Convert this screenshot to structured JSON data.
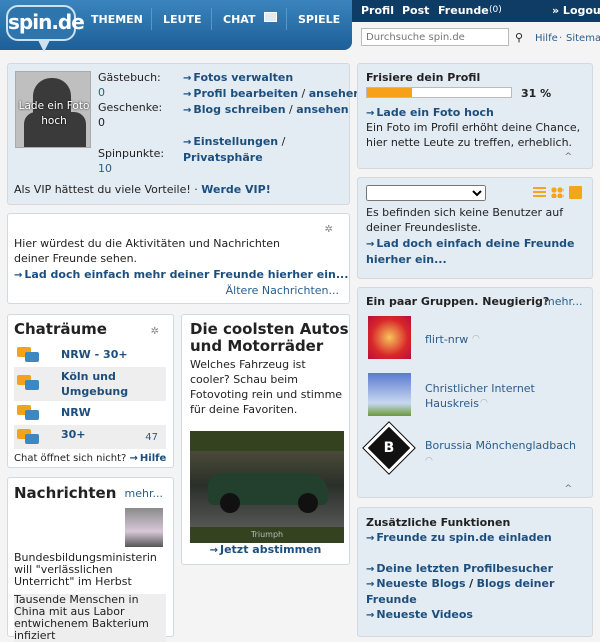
{
  "header": {
    "logo": "spin.de",
    "tabs": [
      "THEMEN",
      "LEUTE",
      "CHAT",
      "SPIELE"
    ],
    "nav": {
      "profil": "Profil",
      "post": "Post",
      "freunde": "Freunde",
      "freunde_count": "(0)",
      "logout": "» Logout"
    },
    "search_placeholder": "Durchsuche spin.de",
    "hilfe": "Hilfe",
    "sitemap": "Sitemap",
    "sep": "·"
  },
  "profile": {
    "photo_label": "Lade ein Foto hoch",
    "guestbook_label": "Gästebuch:",
    "guestbook": "0",
    "gifts_label": "Geschenke:",
    "gifts": "0",
    "points_label": "Spinpunkte:",
    "points": "10",
    "links": {
      "fotos": "Fotos verwalten",
      "profil": "Profil bearbeiten",
      "ansehen": "ansehen",
      "blog": "Blog schreiben",
      "blog_ansehen": "ansehen",
      "einstellungen": "Einstellungen",
      "privat": "Privatsphäre"
    },
    "vip_text": "Als VIP hättest du viele Vorteile! ·",
    "vip_link": "Werde VIP!"
  },
  "activity": {
    "text": "Hier würdest du die Aktivitäten und Nachrichten deiner Freunde sehen.",
    "link": "Lad doch einfach mehr deiner Freunde hierher ein...",
    "older": "Ältere Nachrichten..."
  },
  "chat": {
    "title": "Chaträume",
    "rooms": [
      {
        "name": "NRW - 30+",
        "count": ""
      },
      {
        "name": "Köln und Umgebung",
        "count": ""
      },
      {
        "name": "NRW",
        "count": ""
      },
      {
        "name": "30+",
        "count": "47"
      }
    ],
    "help_text": "Chat öffnet sich nicht?",
    "help_link": "Hilfe"
  },
  "autos": {
    "title": "Die coolsten Autos und Motorräder",
    "text": "Welches Fahrzeug ist cooler? Schau beim Fotovoting rein und stimme für deine Favoriten.",
    "caption": "Triumph",
    "link": "Jetzt abstimmen"
  },
  "news": {
    "title": "Nachrichten",
    "more": "mehr...",
    "items": [
      "Bundesbildungsministerin will \"verlässlichen Unterricht\" im Herbst",
      "Tausende Menschen in China mit aus Labor entwichenem Bakterium infiziert"
    ]
  },
  "profile_progress": {
    "title": "Frisiere dein Profil",
    "percent": 31,
    "percent_label": "31 %",
    "link": "Lade ein Foto hoch",
    "text": "Ein Foto im Profil erhöht deine Chance, hier nette Leute zu treffen, erheblich.",
    "accent": "#f7a11a"
  },
  "friends": {
    "select_value": "",
    "empty": "Es befinden sich keine Benutzer auf deiner Freundesliste.",
    "link": "Lad doch einfach deine Freunde hierher ein..."
  },
  "groups": {
    "title": "Ein paar Gruppen. Neugierig?",
    "more": "mehr...",
    "items": [
      "flirt-nrw",
      "Christlicher Internet Hauskreis",
      "Borussia Mönchengladbach"
    ]
  },
  "extra": {
    "title": "Zusätzliche Funktionen",
    "invite": "Freunde zu spin.de einladen",
    "visitors": "Deine letzten Profilbesucher",
    "blogs": "Neueste Blogs",
    "blogs_friends": "Blogs deiner Freunde",
    "videos": "Neueste Videos"
  }
}
